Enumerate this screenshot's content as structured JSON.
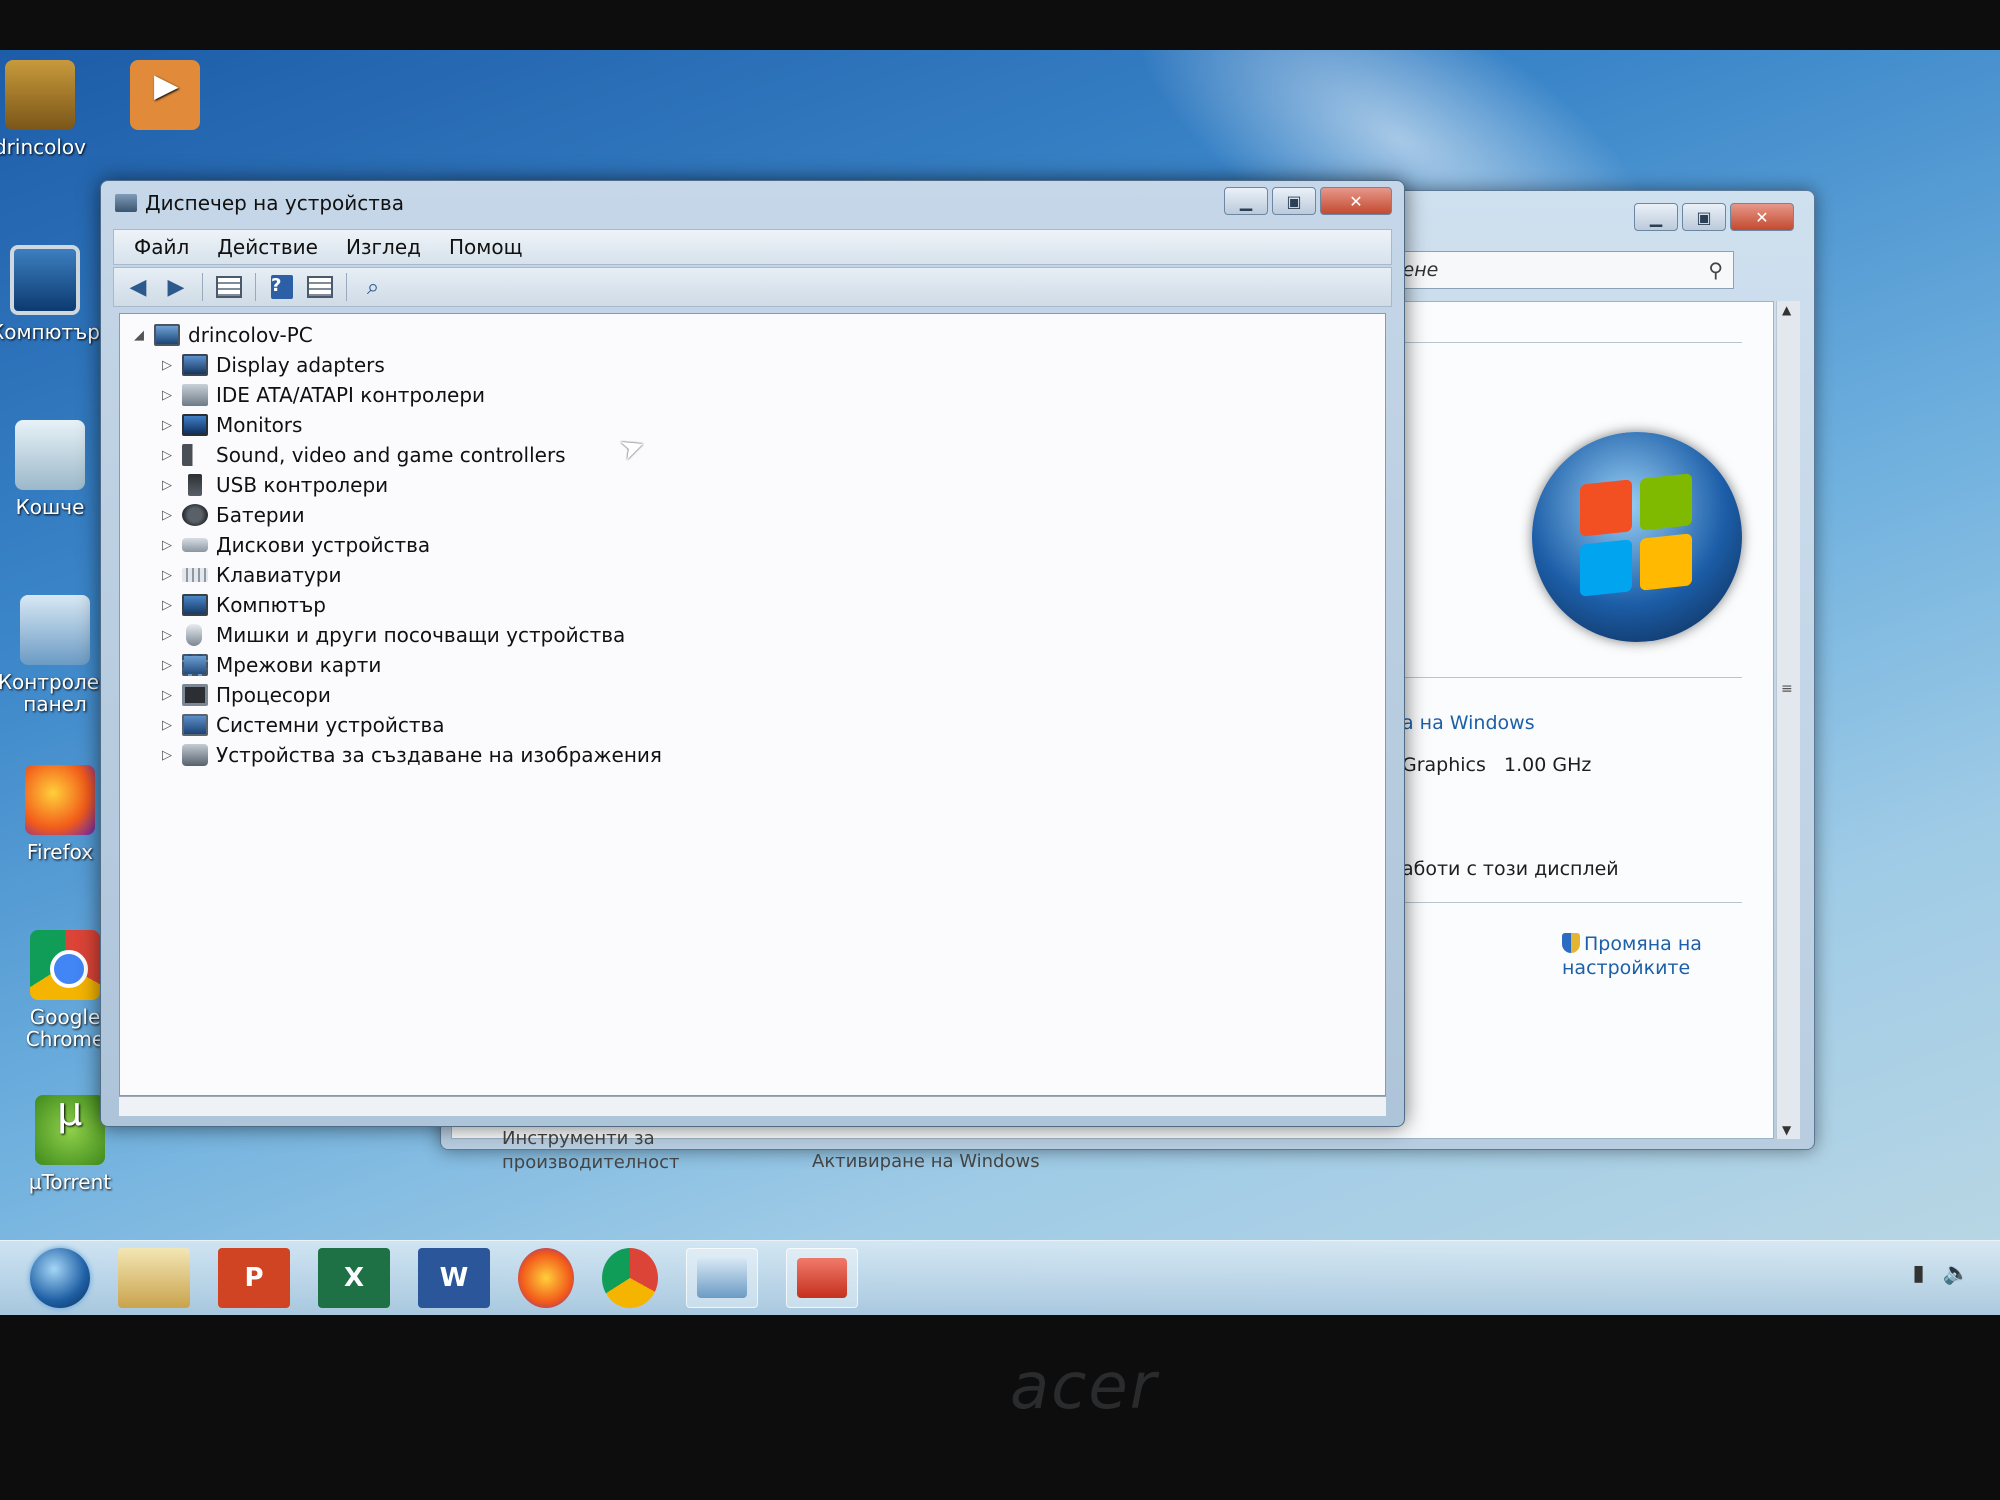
{
  "desktop": {
    "icons": [
      {
        "label": "drincolov",
        "icon": "user-folder-icon"
      },
      {
        "label": "",
        "icon": "media-player-icon"
      },
      {
        "label": "Компютър",
        "icon": "computer-icon"
      },
      {
        "label": "Кошче",
        "icon": "recycle-bin-icon"
      },
      {
        "label": "Контролен панел",
        "icon": "control-panel-icon"
      },
      {
        "label": "Firefox",
        "icon": "firefox-icon"
      },
      {
        "label": "Google Chrome",
        "icon": "chrome-icon"
      },
      {
        "label": "µTorrent",
        "icon": "utorrent-icon"
      }
    ]
  },
  "device_manager": {
    "title": "Диспечер на устройства",
    "menu": [
      "Файл",
      "Действие",
      "Изглед",
      "Помощ"
    ],
    "toolbar": [
      "back-icon",
      "forward-icon",
      "properties-icon",
      "help-icon",
      "view-icon",
      "scan-hardware-icon"
    ],
    "tree": {
      "root": "drincolov-PC",
      "children": [
        "Display adapters",
        "IDE ATA/ATAPI контролери",
        "Monitors",
        "Sound, video and game controllers",
        "USB контролери",
        "Батерии",
        "Дискови устройства",
        "Клавиатури",
        "Компютър",
        "Мишки и други посочващи устройства",
        "Мрежови карти",
        "Процесори",
        "Системни устройства",
        "Устройства за създаване на изображения"
      ]
    }
  },
  "system_window": {
    "search_placeholder": "Търсене",
    "windows_link": "а на Windows",
    "processor_text": "Graphics   1.00 GHz",
    "display_text": "аботи с този дисплей",
    "change_settings": "Промяна на настройките",
    "perf_tools": "Инструменти за производителност",
    "activate": "Активиране на Windows"
  },
  "bezel": {
    "brand": "acer"
  }
}
